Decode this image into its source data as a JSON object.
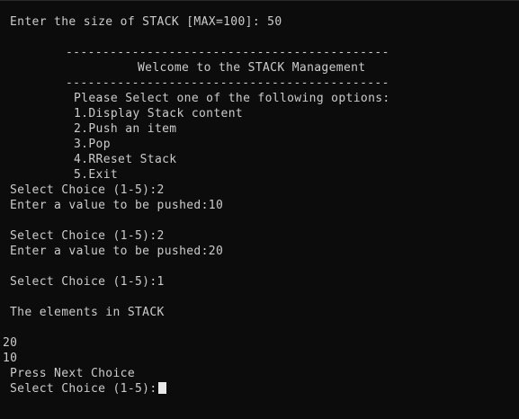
{
  "terminal": {
    "size_prompt": "Enter the size of STACK [MAX=100]: 50",
    "divider_top": "--------------------------------------------",
    "welcome": "Welcome to the STACK Management",
    "divider_bottom": "--------------------------------------------",
    "menu_header": "Please Select one of the following options:",
    "menu_options": [
      "1.Display Stack content",
      "2.Push an item",
      "3.Pop",
      "4.RReset Stack",
      "5.Exit"
    ],
    "session": [
      "Select Choice (1-5):2",
      "Enter a value to be pushed:10",
      "Select Choice (1-5):2",
      "Enter a value to be pushed:20",
      "Select Choice (1-5):1",
      "The elements in STACK",
      "20",
      "10",
      "Press Next Choice",
      "Select Choice (1-5):"
    ]
  }
}
